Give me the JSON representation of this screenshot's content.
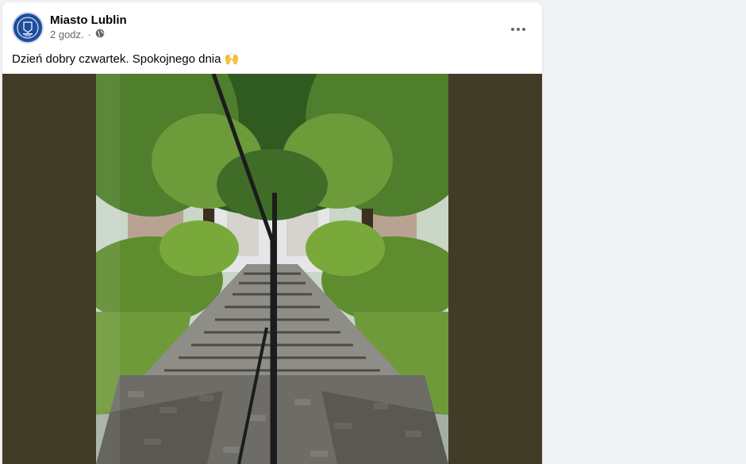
{
  "post": {
    "page_name": "Miasto Lublin",
    "time": "2 godz.",
    "separator": "·",
    "text": "Dzień dobry czwartek. Spokojnego dnia 🙌"
  },
  "icons": {
    "avatar": "lublin-logo",
    "audience": "globe-icon",
    "menu": "more-options-icon"
  },
  "colors": {
    "photo_backdrop": "#413c27",
    "page_background": "#f0f2f5",
    "logo_blue": "#1d4e9e"
  }
}
